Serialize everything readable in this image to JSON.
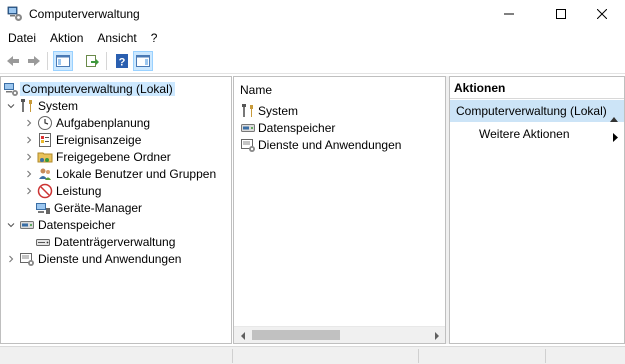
{
  "window": {
    "title": "Computerverwaltung",
    "icon": "computer-management-icon"
  },
  "menu": [
    "Datei",
    "Aktion",
    "Ansicht",
    "?"
  ],
  "toolbar": {
    "buttons": [
      "back-arrow-icon",
      "forward-arrow-icon",
      "show-hide-console-tree-icon",
      "export-list-icon",
      "help-icon",
      "properties-pane-icon"
    ]
  },
  "tree": {
    "root": "Computerverwaltung (Lokal)",
    "system": "System",
    "system_children": [
      "Aufgabenplanung",
      "Ereignisanzeige",
      "Freigegebene Ordner",
      "Lokale Benutzer und Gruppen",
      "Leistung",
      "Geräte-Manager"
    ],
    "storage": "Datenspeicher",
    "storage_children": [
      "Datenträgerverwaltung"
    ],
    "services": "Dienste und Anwendungen"
  },
  "list": {
    "header": "Name",
    "items": [
      "System",
      "Datenspeicher",
      "Dienste und Anwendungen"
    ]
  },
  "actions": {
    "header": "Aktionen",
    "section": "Computerverwaltung (Lokal)",
    "item": "Weitere Aktionen"
  },
  "colors": {
    "selection": "#cce8ff",
    "actions_section": "#cce4f7"
  }
}
